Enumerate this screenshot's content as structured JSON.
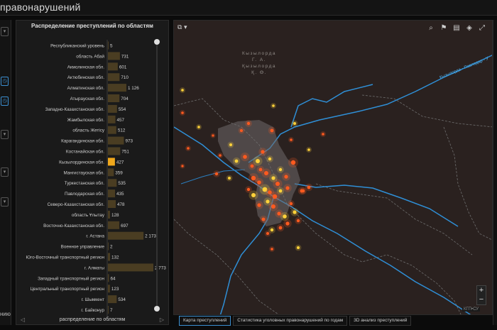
{
  "window": {
    "title": "правонарушений"
  },
  "left_strip": {
    "partial_label": "нию"
  },
  "chart_panel": {
    "title": "Распределение преступлений по областям",
    "footer_label": "распределение по областям"
  },
  "chart_data": {
    "type": "bar",
    "orientation": "horizontal",
    "title": "Распределение преступлений по областям",
    "categories": [
      "Республиканский уровень",
      "область Абай",
      "Акмолинская обл.",
      "Актюбинская обл.",
      "Алматинская обл.",
      "Атырауская обл.",
      "Западно-Казахстанская обл.",
      "Жамбылская обл.",
      "область Жетісу",
      "Карагандинская обл.",
      "Костанайская обл.",
      "Кызылординская обл.",
      "Мангистауская обл.",
      "Туркестанская обл.",
      "Павлодарская обл.",
      "Северо-Казахстанская обл.",
      "область Ұлытау",
      "Восточно-Казахстанская обл.",
      "г. Астана",
      "Военное управление",
      "Юго-Восточный транспортный регион",
      "г. Алматы",
      "Западный транспортный регион",
      "Центральный транспортный регион",
      "г. Шымкент",
      "г. Байконур"
    ],
    "values": [
      5,
      731,
      601,
      710,
      1126,
      704,
      554,
      457,
      512,
      973,
      751,
      427,
      359,
      535,
      435,
      478,
      128,
      697,
      2173,
      2,
      132,
      2773,
      64,
      123,
      534,
      7
    ],
    "value_labels": [
      "5",
      "731",
      "601",
      "710",
      "1 126",
      "704",
      "554",
      "457",
      "512",
      "973",
      "751",
      "427",
      "359",
      "535",
      "435",
      "478",
      "128",
      "697",
      "2 173",
      "2",
      "132",
      "2 773",
      "64",
      "123",
      "534",
      "7"
    ],
    "highlighted": "Кызылординская обл.",
    "colors": {
      "bar": "#4a3d22",
      "bar_highlight": "#f0a81c"
    }
  },
  "map": {
    "city_label": [
      "Кызылорда",
      "Г. А.",
      "Қызылорда",
      "Қ. Ө."
    ],
    "road_label": "Кызылорда - Павлодар - У",
    "attribution": "КГП•СУ",
    "colors": {
      "background": "#2a211f",
      "river": "#2f8fd6",
      "city_area": "#6d6a6a",
      "hotspot_low": "#ff5a1f",
      "hotspot_high": "#ffd23a"
    }
  },
  "toolbar": {
    "icons": [
      "search-icon",
      "bookmark-icon",
      "basemap-icon",
      "layers-icon",
      "fullscreen-icon"
    ],
    "zoom_in": "+",
    "zoom_out": "−"
  },
  "tabs": [
    {
      "label": "Карта преступлений",
      "active": true
    },
    {
      "label": "Статистика уголовных правонарушений по годам",
      "active": false
    },
    {
      "label": "3D анализ преступлений",
      "active": false
    }
  ]
}
